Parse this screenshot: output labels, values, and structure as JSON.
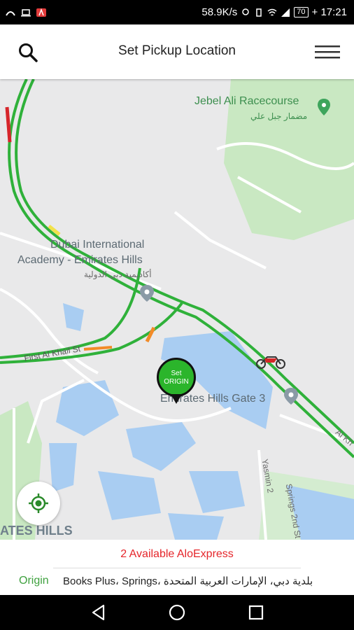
{
  "status_bar": {
    "speed": "58.9K/s",
    "battery": "70",
    "time": "17:21"
  },
  "header": {
    "title": "Set Pickup Location",
    "search_icon": "search-icon",
    "menu_icon": "hamburger-menu-icon"
  },
  "map": {
    "labels": {
      "racecourse_en": "Jebel Ali Racecourse",
      "racecourse_ar": "مضمار جبل علي",
      "academy_line1": "Dubai International",
      "academy_line2": "Academy - Emirates Hills",
      "academy_ar": "أكاديمية دبي الدولية",
      "first_al_khail": "First Al Khail St",
      "gate3": "Emirates Hills Gate 3",
      "al_khail_cut": "Al Kh",
      "yasmin": "Yasmin 2",
      "springs_cut": "Springs 2nd St",
      "area": "ATES HILLS"
    },
    "pin": {
      "line1": "Set",
      "line2": "ORIGIN"
    },
    "colors": {
      "road_green": "#2fb13a",
      "road_red": "#d6262b",
      "road_orange": "#f28b28",
      "park": "#c9e8c2",
      "water": "#a9cdf2"
    }
  },
  "bottom_panel": {
    "availability": "2 Available AloExpress",
    "origin_label": "Origin",
    "origin_address": "Books Plus، Springs، بلدية دبي، الإمارات العربية المتحدة"
  },
  "nav_bar": {
    "back_icon": "back-triangle-icon",
    "home_icon": "home-circle-icon",
    "recents_icon": "recents-square-icon"
  }
}
